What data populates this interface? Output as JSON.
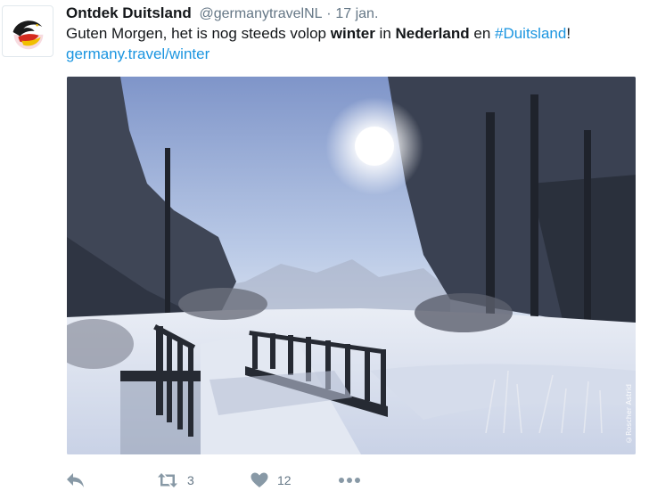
{
  "tweet": {
    "author_name": "Ontdek Duitsland",
    "handle": "@germanytravelNL",
    "separator": "·",
    "date": "17 jan.",
    "text": {
      "part1": "Guten Morgen, het is nog steeds volop ",
      "bold1": "winter",
      "part2": " in ",
      "bold2": "Nederland",
      "part3": " en ",
      "hashtag": "#Duitsland",
      "part4": "!"
    },
    "link": "germany.travel/winter",
    "media": {
      "watermark": "©Roscher Astrid"
    }
  },
  "actions": {
    "reply": {
      "icon": "reply-icon"
    },
    "retweet": {
      "icon": "retweet-icon",
      "count": "3"
    },
    "like": {
      "icon": "heart-icon",
      "count": "12"
    },
    "more": {
      "icon": "more-dots-icon"
    }
  },
  "colors": {
    "link": "#1b95e0",
    "secondary_text": "#657786",
    "icon": "#8899a6"
  }
}
